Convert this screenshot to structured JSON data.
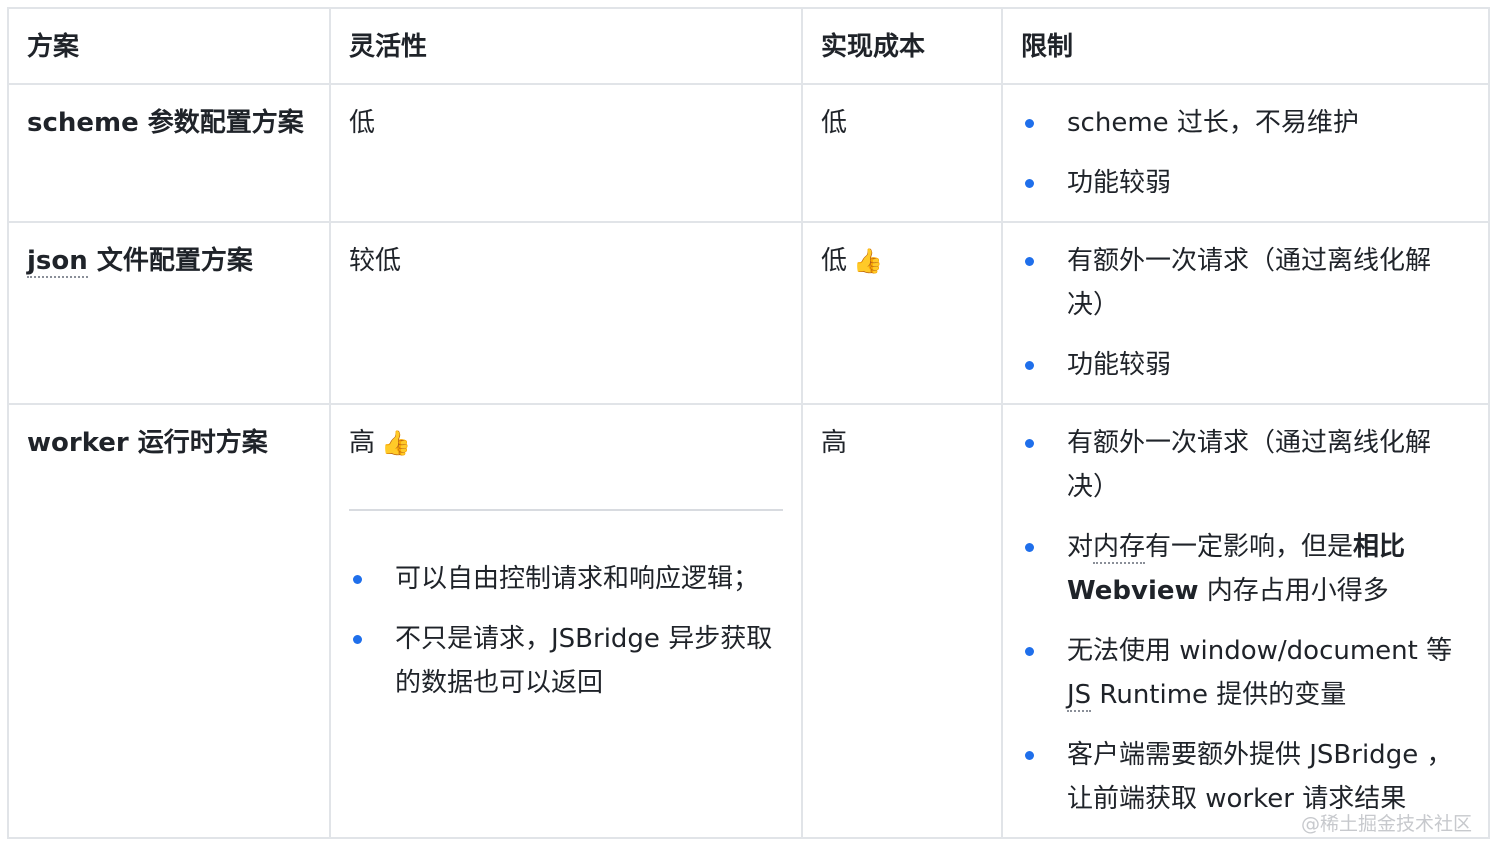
{
  "headers": [
    "方案",
    "灵活性",
    "实现成本",
    "限制"
  ],
  "rows": [
    {
      "scheme": "scheme 参数配置方案",
      "flex": "低",
      "cost": "低",
      "limits": [
        "scheme 过长，不易维护",
        "功能较弱"
      ]
    },
    {
      "scheme_prefix": "json",
      "scheme_suffix": " 文件配置方案",
      "flex": "较低",
      "cost": "低",
      "cost_icon": "👍",
      "limits": [
        "有额外一次请求（通过离线化解决）",
        "功能较弱"
      ]
    },
    {
      "scheme": "worker 运行时方案",
      "flex": "高",
      "flex_icon": "👍",
      "flex_points": [
        "可以自由控制请求和响应逻辑；",
        "不只是请求，JSBridge 异步获取的数据也可以返回"
      ],
      "cost": "高",
      "limit1": "有额外一次请求（通过离线化解决）",
      "limit2_a": "对",
      "limit2_b": "内存",
      "limit2_c": "有一定影响，但是",
      "limit2_bold": "相比 Webview",
      "limit2_d": " 内存占用小得多",
      "limit3_a": "无法使用 window/document 等 ",
      "limit3_b": "JS",
      "limit3_c": " Runtime 提供的变量",
      "limit4": "客户端需要额外提供 JSBridge ，让前端获取 worker 请求结果"
    }
  ],
  "watermark": "@稀土掘金技术社区"
}
